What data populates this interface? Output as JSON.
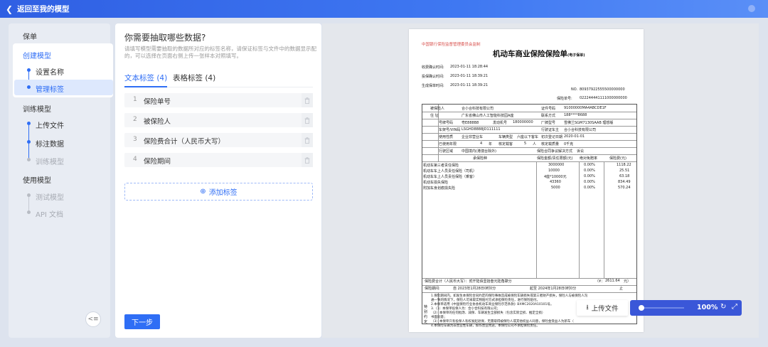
{
  "header": {
    "back_label": "返回至我的模型"
  },
  "sidebar": {
    "sections": [
      {
        "title": "保单",
        "items": []
      },
      {
        "title": "创建模型",
        "items": [
          "设置名称",
          "管理标签"
        ]
      },
      {
        "title": "训练模型",
        "items": [
          "上传文件",
          "标注数据",
          "训练模型"
        ]
      },
      {
        "title": "使用模型",
        "items": [
          "测试模型",
          "API 文档"
        ]
      }
    ]
  },
  "form": {
    "heading": "你需要抽取哪些数据?",
    "description": "请填写模型需要抽取的数据所对应的标签名称，请保证标签与文件中的数据显示配的，可以选择在页面右侧上传一张样本对照填写。",
    "tabs": [
      {
        "label": "文本标签 (4)"
      },
      {
        "label": "表格标签 (4)"
      }
    ],
    "labels": [
      {
        "num": "1",
        "text": "保险单号"
      },
      {
        "num": "2",
        "text": "被保险人"
      },
      {
        "num": "3",
        "text": "保险费合计（人民币大写）"
      },
      {
        "num": "4",
        "text": "保险期间"
      }
    ],
    "add_label": "添加标签",
    "next_label": "下一步"
  },
  "document": {
    "issuer": "中国银行保险监督管理委员会监制",
    "title": "机动车商业保险保险单",
    "title_sub": "(电子保单)",
    "meta": [
      {
        "k": "收费确认时间:",
        "v": "2023-01-11 18:28:44"
      },
      {
        "k": "投保确认时间:",
        "v": "2023-01-11 18:39:21"
      },
      {
        "k": "生成保单时间:",
        "v": "2023-01-11 18:39:21"
      }
    ],
    "no_label": "NO.",
    "no_value": "80937922555500000000",
    "policy_no_label": "保险单号:",
    "policy_no_value": "022244441111000000000",
    "insured_label": "被保险人",
    "insured_value": "合小合科技有限公司",
    "id_label": "证件号码",
    "id_value": "91000000MA4ABCDE1F",
    "address_label": "住  址",
    "address_value": "广东省佛山市人工智能科技园A座",
    "phone_label": "联系方式",
    "phone_value": "188****8688",
    "plate_label": "号牌号码",
    "plate_value": "粤E888B8",
    "engine_label": "发动机号",
    "engine_value": "180000000",
    "model_label": "厂牌型号",
    "model_value": "雪佛兰SGM7130SAAB 理想版",
    "vin_label": "车架号/VIN码",
    "vin_value": "LSGHD8888JD111111",
    "owner_label": "行驶证车主",
    "owner_value": "合小合科技有限公司",
    "use_label": "使用性质",
    "use_value": "企业非营业车",
    "type_label": "车辆类型",
    "type_value": "六座以下客车",
    "reg_label": "初次登记日期",
    "reg_value": "2020-01-01",
    "years_label": "已使用年限",
    "years_value": "4",
    "years_unit": "年",
    "seats_label": "核定载客",
    "seats_value": "5",
    "seats_unit": "人",
    "load_label": "核定载质量",
    "load_value": "0千克",
    "area_label": "行驶区域",
    "area_value": "中国境内(港澳台除外)",
    "method_label": "保险合同争议解决方式",
    "method_value": "诉讼",
    "cov_headers": [
      "承保险种",
      "保险金额/责任限额(元)",
      "绝对免赔率",
      "保险费(元)"
    ],
    "coverages": [
      [
        "机动车第三者责任保险",
        "3000000",
        "0.00%",
        "1118.22"
      ],
      [
        "机动车车上人员责任保险（司机）",
        "10000",
        "0.00%",
        "25.51"
      ],
      [
        "机动车车上人员责任保险（乘客）",
        "4座*10000元",
        "0.00%",
        "63.18"
      ],
      [
        "机动车损失保险",
        "43360",
        "0.00%",
        "834.49"
      ],
      [
        "附加车身划痕损失险",
        "5000",
        "0.00%",
        "570.24"
      ]
    ],
    "premium_label": "保险费合计（人民币大写）：贰仟陆佰壹拾叁元陆角肆分",
    "premium_value_label": "（¥：",
    "premium_value": "2611.64",
    "premium_unit": "元）",
    "period_label": "保险期间:",
    "period_from": "自 2023年1月28日0时0分",
    "period_to": "起至  2024年1月28日0时0分",
    "period_end": "止",
    "terms_label": "特别约定",
    "terms": [
      "1.保险期间内，如发生本保险合同约定的保险事故造成被保险车辆损失或第三者财产损失，保险人与被保险人沟",
      "通一致的情况下，保险人可采取实物赔付方式承担保险责任，进行保险赔付。",
      "2.本保单适用《中国保险行业协会机动车商业保险示范条款》BXMC2020A10101号。",
      "3.（1）本保单投保人为：合小合科技有限公司；",
      "（2）本保单的任何批改、减保、车辆发生全部损失（包含实际全损、推定全损）",
      "书面同意；",
      "（3）本保单只有投保人有权发起退保，无需取得被保险人或其他权益人同意，保险金受益人为新车（",
      "4.本保险车辆为非营业性车辆，如作营业用途，本保险公司不承担保险责任。"
    ]
  },
  "toolbar": {
    "upload_label": "上传文件",
    "zoom_value": 0,
    "zoom_label": "100%"
  }
}
